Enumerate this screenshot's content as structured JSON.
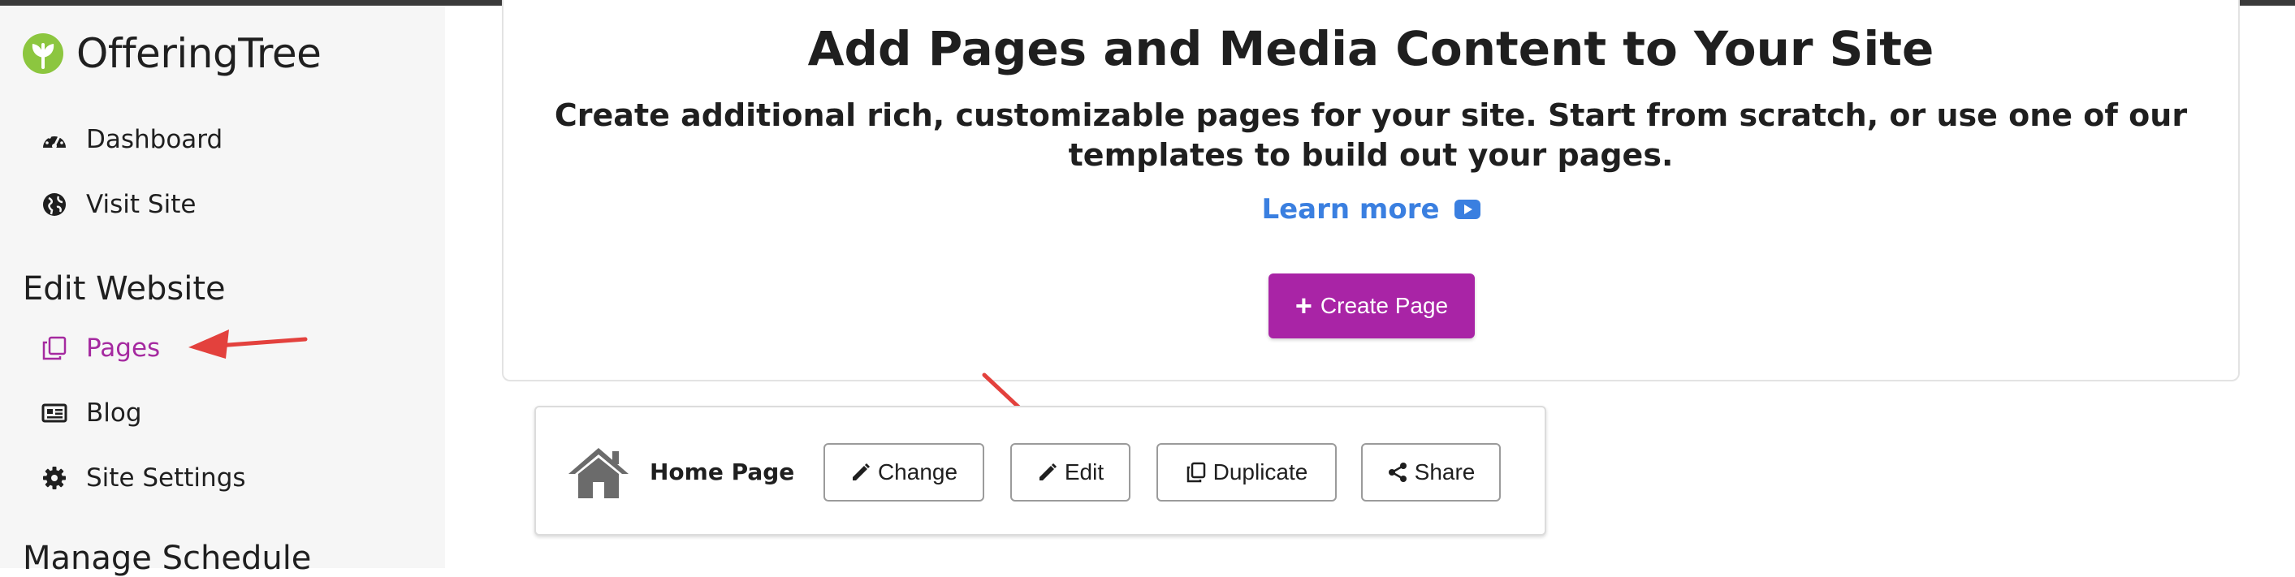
{
  "app": {
    "name": "OfferingTree"
  },
  "colors": {
    "accent": "#a924a6",
    "link": "#3a7fe0",
    "annotation": "#e3413d"
  },
  "sidebar": {
    "items_top": [
      {
        "label": "Dashboard",
        "icon": "dashboard-icon"
      },
      {
        "label": "Visit Site",
        "icon": "globe-icon"
      }
    ],
    "section_edit": "Edit Website",
    "items_edit": [
      {
        "label": "Pages",
        "icon": "pages-icon",
        "active": true
      },
      {
        "label": "Blog",
        "icon": "newspaper-icon"
      },
      {
        "label": "Site Settings",
        "icon": "gear-icon"
      }
    ],
    "section_schedule": "Manage Schedule"
  },
  "hero": {
    "title": "Add Pages and Media Content to Your Site",
    "subtitle": "Create additional rich, customizable pages for your site. Start from scratch, or use one of our templates to build out your pages.",
    "learn_more": "Learn more",
    "create_button": "Create Page"
  },
  "home_row": {
    "label": "Home Page",
    "buttons": {
      "change": "Change",
      "edit": "Edit",
      "duplicate": "Duplicate",
      "share": "Share"
    }
  }
}
